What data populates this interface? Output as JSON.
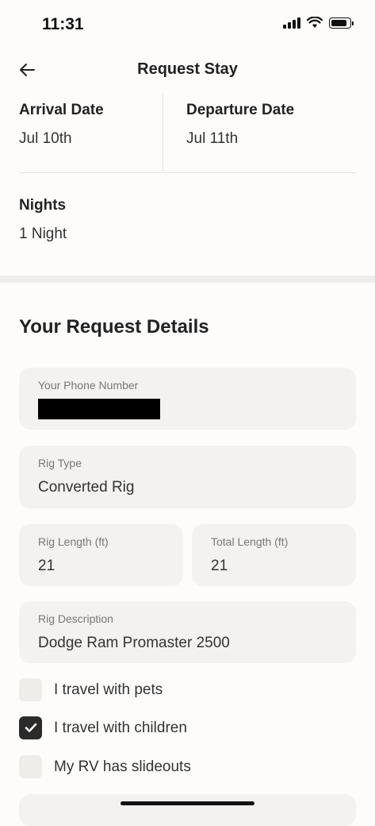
{
  "status_bar": {
    "time": "11:31"
  },
  "nav": {
    "title": "Request Stay"
  },
  "dates": {
    "arrival_label": "Arrival Date",
    "arrival_value": "Jul 10th",
    "departure_label": "Departure Date",
    "departure_value": "Jul 11th",
    "nights_label": "Nights",
    "nights_value": "1 Night"
  },
  "details": {
    "title": "Your Request Details",
    "phone_label": "Your Phone Number",
    "rig_type_label": "Rig Type",
    "rig_type_value": "Converted Rig",
    "rig_length_label": "Rig Length (ft)",
    "rig_length_value": "21",
    "total_length_label": "Total Length (ft)",
    "total_length_value": "21",
    "rig_description_label": "Rig Description",
    "rig_description_value": "Dodge Ram Promaster 2500"
  },
  "options": [
    {
      "label": "I travel with pets",
      "checked": false
    },
    {
      "label": "I travel with children",
      "checked": true
    },
    {
      "label": "My RV has slideouts",
      "checked": false
    }
  ]
}
